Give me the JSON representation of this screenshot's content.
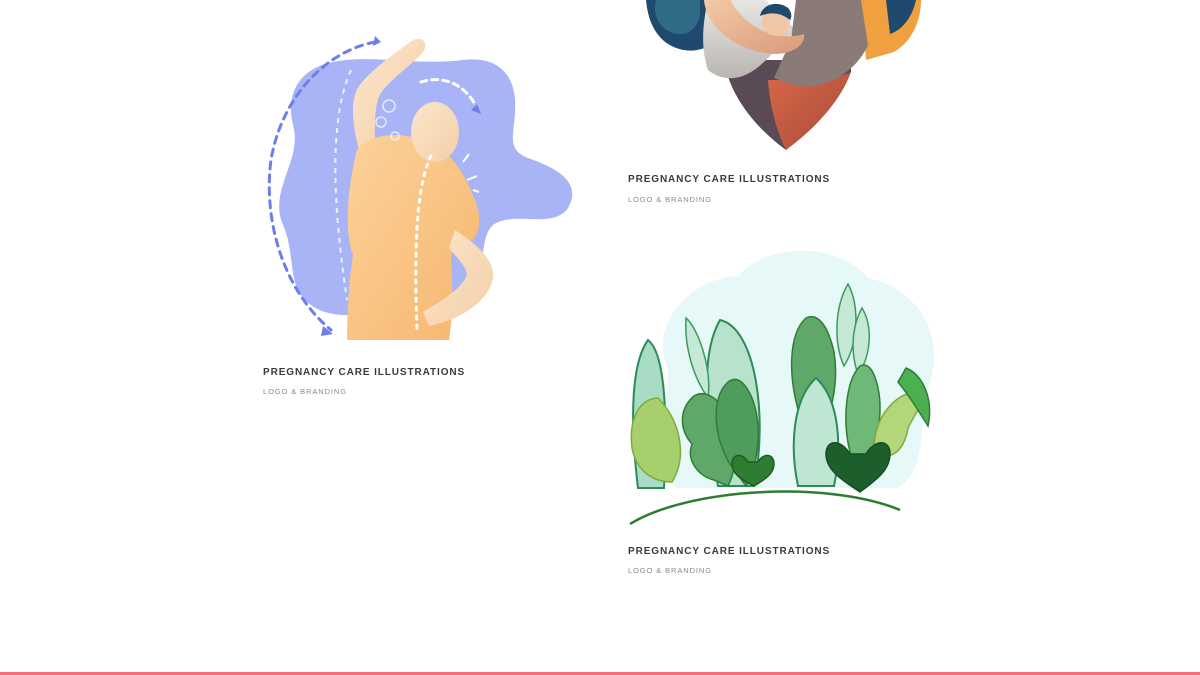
{
  "colors": {
    "accent_bar": "#f26d7d",
    "title_text": "#3a3a3a",
    "subtitle_text": "#8a8a8a"
  },
  "portfolio": {
    "items": [
      {
        "title": "PREGNANCY CARE ILLUSTRATIONS",
        "category": "LOGO & BRANDING",
        "illustration": "mother-holding-baby-heart"
      },
      {
        "title": "PREGNANCY CARE ILLUSTRATIONS",
        "category": "LOGO & BRANDING",
        "illustration": "person-stretching-back"
      },
      {
        "title": "PREGNANCY CARE ILLUSTRATIONS",
        "category": "LOGO & BRANDING",
        "illustration": "green-plants-leaves"
      }
    ]
  }
}
